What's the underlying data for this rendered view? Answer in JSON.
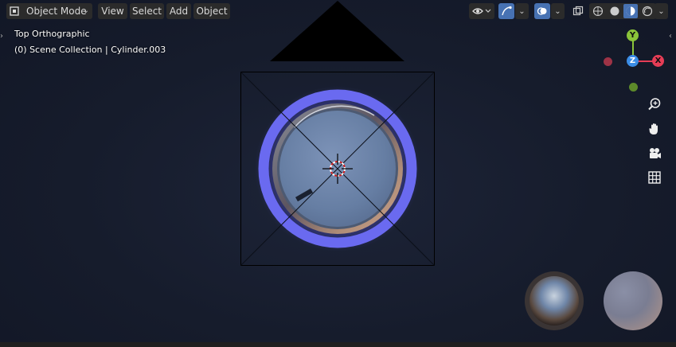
{
  "header": {
    "mode_label": "Object Mode",
    "menus": [
      "View",
      "Select",
      "Add",
      "Object"
    ]
  },
  "overlay": {
    "view_name": "Top Orthographic",
    "collection_line": "(0) Scene Collection | Cylinder.003"
  },
  "gizmo": {
    "y_label": "Y",
    "z_label": "Z",
    "x_label": "X",
    "x_color": "#e63d56",
    "y_color": "#8bc43a",
    "z_color": "#3b8de6"
  },
  "navigation": [
    "zoom-icon",
    "hand-icon",
    "camera-icon",
    "grid-icon"
  ],
  "colors": {
    "ring": "#6a6af0",
    "glass": "#6e87ad",
    "active_toggle": "#4772b3"
  }
}
